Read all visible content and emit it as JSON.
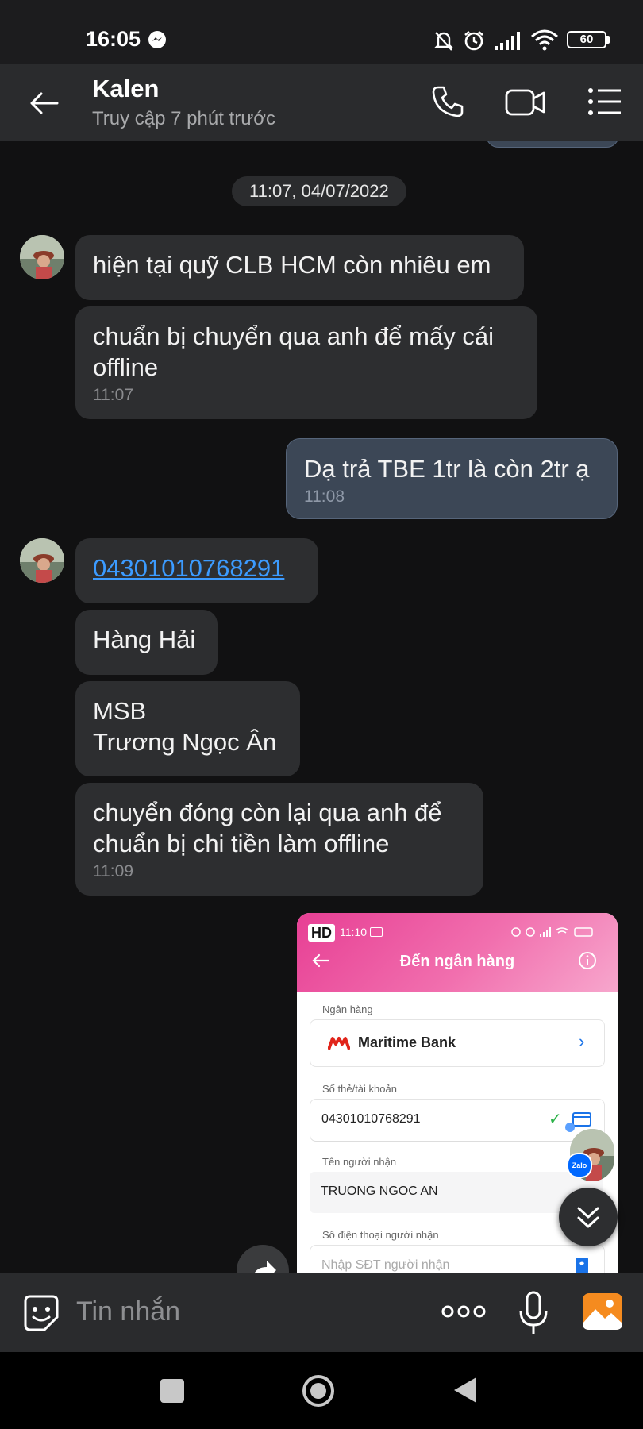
{
  "status_bar": {
    "time": "16:05",
    "battery": "60"
  },
  "header": {
    "contact_name": "Kalen",
    "presence": "Truy cập 7 phút trước"
  },
  "chat": {
    "date_separator": "11:07, 04/07/2022",
    "messages": [
      {
        "sender": "Kalen",
        "text": "hiện tại quỹ CLB HCM còn nhiêu em"
      },
      {
        "sender": "Kalen",
        "text_line1": "chuẩn bị chuyển qua anh để mấy cái",
        "text_line2": "offline",
        "time": "11:07"
      },
      {
        "sender": "me",
        "text": "Dạ trả TBE 1tr là còn 2tr ạ",
        "time": "11:08"
      },
      {
        "sender": "Kalen",
        "text": "04301010768291"
      },
      {
        "sender": "Kalen",
        "text": "Hàng Hải"
      },
      {
        "sender": "Kalen",
        "text_line1": "MSB",
        "text_line2": "Trương Ngọc Ân"
      },
      {
        "sender": "Kalen",
        "text_line1": "chuyển đóng còn lại qua anh để",
        "text_line2": "chuẩn bị chi tiền làm offline",
        "time": "11:09"
      }
    ],
    "image_message": {
      "hd_badge": "HD",
      "status_time": "11:10",
      "title": "Đến ngân hàng",
      "bank_label": "Ngân hàng",
      "bank_name": "Maritime Bank",
      "account_label": "Số thẻ/tài khoản",
      "account_value": "04301010768291",
      "recipient_label": "Tên người nhận",
      "recipient_value": "TRUONG NGOC AN",
      "phone_label": "Số điện thoại người nhận",
      "phone_placeholder": "Nhập SĐT người nhận",
      "zalo_badge": "Zalo"
    }
  },
  "composer": {
    "placeholder": "Tin nhắn"
  },
  "colors": {
    "link": "#3c9bff",
    "accent_pink": "#e73f94",
    "my_bubble": "#3c4756",
    "their_bubble": "#2d2e30"
  }
}
